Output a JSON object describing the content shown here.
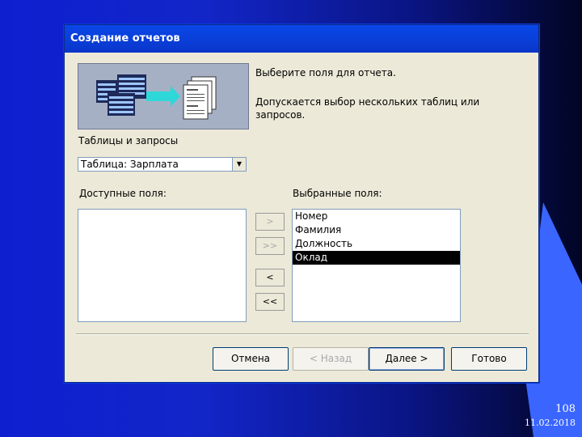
{
  "dialog": {
    "title": "Создание отчетов",
    "instruction_1": "Выберите поля для отчета.",
    "instruction_2_line1": "Допускается выбор нескольких таблиц или",
    "instruction_2_line2": "запросов.",
    "tables_label": "Таблицы и запросы",
    "table_select": {
      "value": "Таблица: Зарплата"
    },
    "available_label": "Доступные поля:",
    "selected_label": "Выбранные поля:",
    "available_fields": [],
    "selected_fields": [
      "Номер",
      "Фамилия",
      "Должность",
      "Оклад"
    ],
    "highlighted_field": "Оклад",
    "move_buttons": {
      "add_one": ">",
      "add_all": ">>",
      "remove_one": "<",
      "remove_all": "<<"
    },
    "buttons": {
      "cancel": "Отмена",
      "back": "< Назад",
      "next": "Далее >",
      "finish": "Готово"
    }
  },
  "slide": {
    "page_number": "108",
    "date": "11.02.2018"
  },
  "icons": {
    "hero": "tables-to-report-illustration",
    "dropdown": "triangle-down-icon"
  }
}
